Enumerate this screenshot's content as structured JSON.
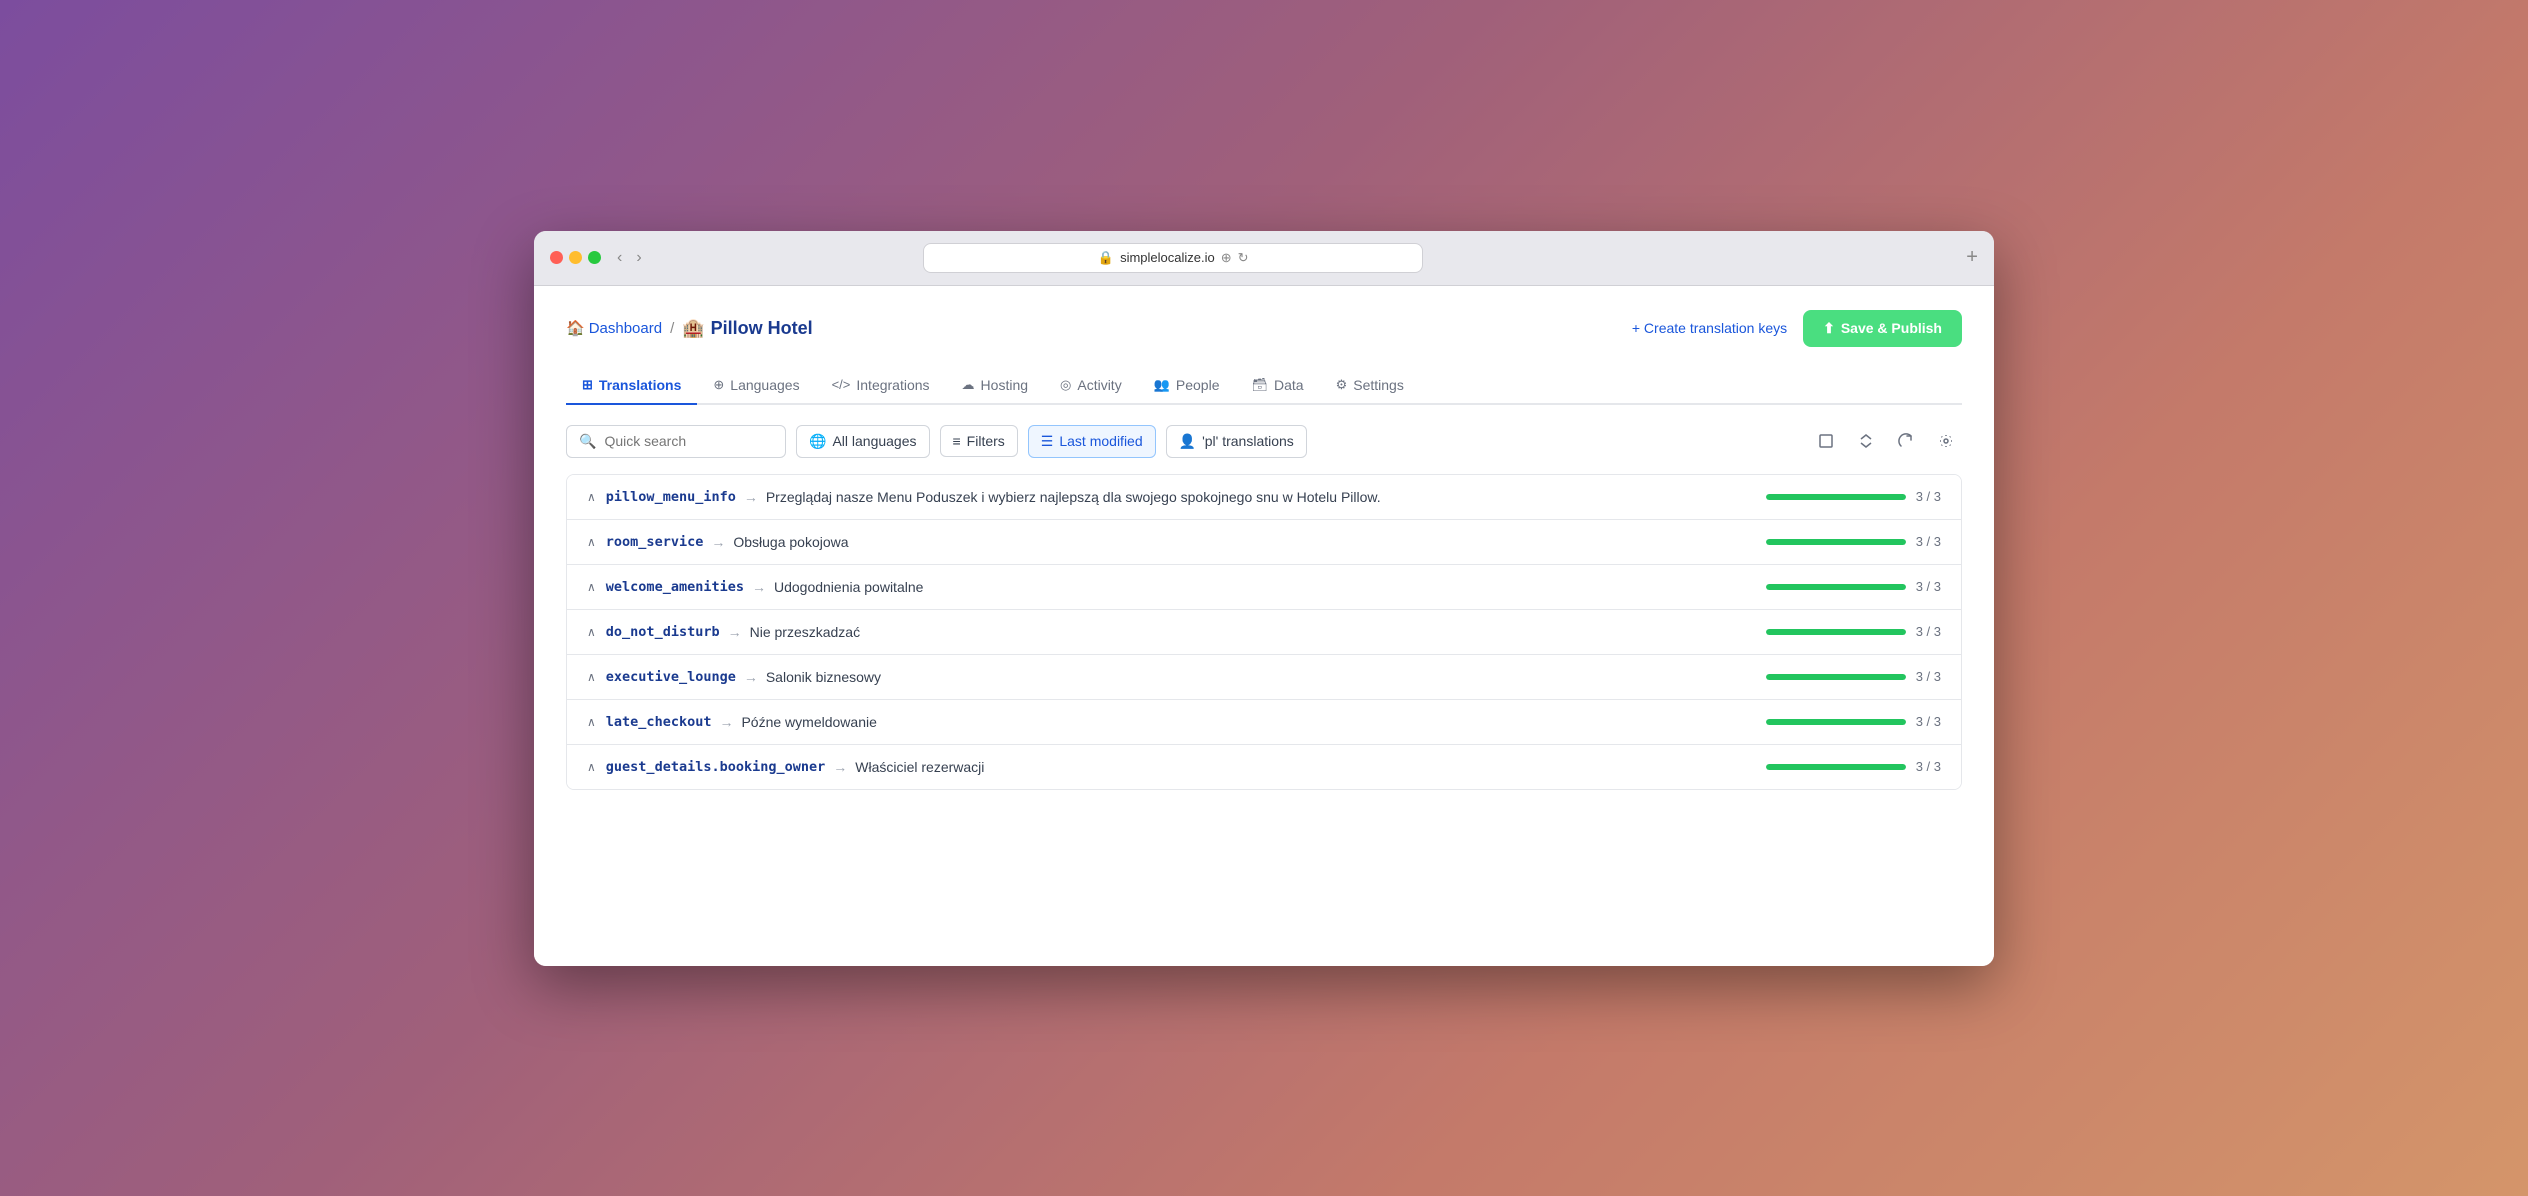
{
  "browser": {
    "url": "simplelocalize.io",
    "plus_label": "+"
  },
  "breadcrumb": {
    "home_label": "Dashboard",
    "separator": "/",
    "project_emoji": "🏨",
    "project_name": "Pillow Hotel"
  },
  "actions": {
    "create_keys_label": "+ Create translation keys",
    "save_publish_label": "Save & Publish"
  },
  "tabs": [
    {
      "id": "translations",
      "label": "Translations",
      "active": true
    },
    {
      "id": "languages",
      "label": "Languages",
      "active": false
    },
    {
      "id": "integrations",
      "label": "Integrations",
      "active": false
    },
    {
      "id": "hosting",
      "label": "Hosting",
      "active": false
    },
    {
      "id": "activity",
      "label": "Activity",
      "active": false
    },
    {
      "id": "people",
      "label": "People",
      "active": false
    },
    {
      "id": "data",
      "label": "Data",
      "active": false
    },
    {
      "id": "settings",
      "label": "Settings",
      "active": false
    }
  ],
  "toolbar": {
    "search_placeholder": "Quick search",
    "all_languages_label": "All languages",
    "filters_label": "Filters",
    "last_modified_label": "Last modified",
    "pl_translations_label": "'pl' translations"
  },
  "translations": [
    {
      "key": "pillow_menu_info",
      "translation": "Przeglądaj nasze Menu Poduszek i wybierz najlepszą dla swojego spokojnego snu w Hotelu Pillow.",
      "progress": 100,
      "count": "3 / 3"
    },
    {
      "key": "room_service",
      "translation": "Obsługa pokojowa",
      "progress": 100,
      "count": "3 / 3"
    },
    {
      "key": "welcome_amenities",
      "translation": "Udogodnienia powitalne",
      "progress": 100,
      "count": "3 / 3"
    },
    {
      "key": "do_not_disturb",
      "translation": "Nie przeszkadzać",
      "progress": 100,
      "count": "3 / 3"
    },
    {
      "key": "executive_lounge",
      "translation": "Salonik biznesowy",
      "progress": 100,
      "count": "3 / 3"
    },
    {
      "key": "late_checkout",
      "translation": "Późne wymeldowanie",
      "progress": 100,
      "count": "3 / 3"
    },
    {
      "key": "guest_details.booking_owner",
      "translation": "Właściciel rezerwacji",
      "progress": 100,
      "count": "3 / 3"
    }
  ]
}
